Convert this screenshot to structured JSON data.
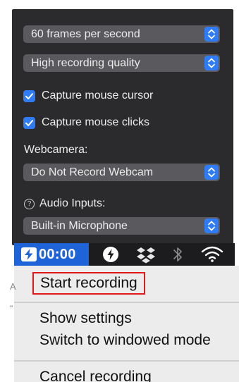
{
  "settings": {
    "framerate": {
      "value": "60 frames per second"
    },
    "quality": {
      "value": "High recording quality"
    },
    "capture_cursor": {
      "label": "Capture mouse cursor",
      "checked": true
    },
    "capture_clicks": {
      "label": "Capture mouse clicks",
      "checked": true
    },
    "webcam": {
      "label": "Webcamera:",
      "value": "Do Not Record Webcam"
    },
    "audio": {
      "label": "Audio Inputs:",
      "help_glyph": "?",
      "value": "Built-in Microphone"
    }
  },
  "menubar": {
    "recording_time": "00:00",
    "icons": [
      "recorder-logo-icon",
      "flash-icon",
      "dropbox-icon",
      "bluetooth-icon",
      "wifi-icon"
    ]
  },
  "menu": {
    "items": [
      {
        "label": "Start recording",
        "highlighted": true
      },
      {
        "label": "Show settings"
      },
      {
        "label": "Switch to windowed mode"
      },
      {
        "label": "Cancel recording"
      }
    ]
  },
  "ghost_text": {
    "a": "A",
    "quote": "“"
  },
  "colors": {
    "panel_bg": "#2b2b2d",
    "select_bg": "#5a5a5e",
    "accent": "#2f7cf6",
    "menubar_bg": "#1c1c1e",
    "recording_badge": "#1f63d8",
    "menu_bg": "#ececec",
    "highlight_border": "#e01a1a"
  }
}
